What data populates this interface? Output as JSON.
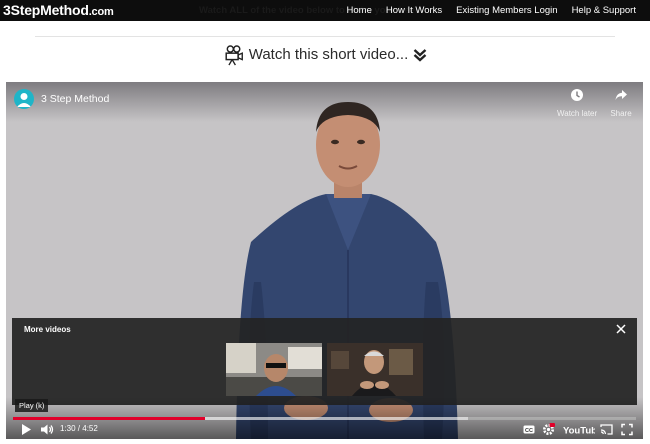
{
  "site": {
    "logo_prefix": "3",
    "logo_name": "StepMethod",
    "logo_domain": ".com",
    "top_notice": "Watch ALL of the video below to claim your free..."
  },
  "nav": {
    "items": [
      {
        "label": "Home"
      },
      {
        "label": "How It Works"
      },
      {
        "label": "Existing Members Login"
      },
      {
        "label": "Help & Support"
      }
    ]
  },
  "heading": {
    "text": "Watch this short video...",
    "icon": "movie-camera-icon",
    "chevron": "double-chevron-down-icon"
  },
  "player": {
    "channel_title": "3 Step Method",
    "watch_later_label": "Watch later",
    "share_label": "Share",
    "more_videos_title": "More videos",
    "play_tooltip": "Play (k)",
    "time_readout": "1:30 / 4:52",
    "progress_fraction": 0.308,
    "buffered_fraction": 0.73,
    "progress_color": "#e1002a",
    "channel_avatar_color": "#1fb5c8",
    "youtube_label": "YouTube",
    "cc_label": "CC"
  }
}
